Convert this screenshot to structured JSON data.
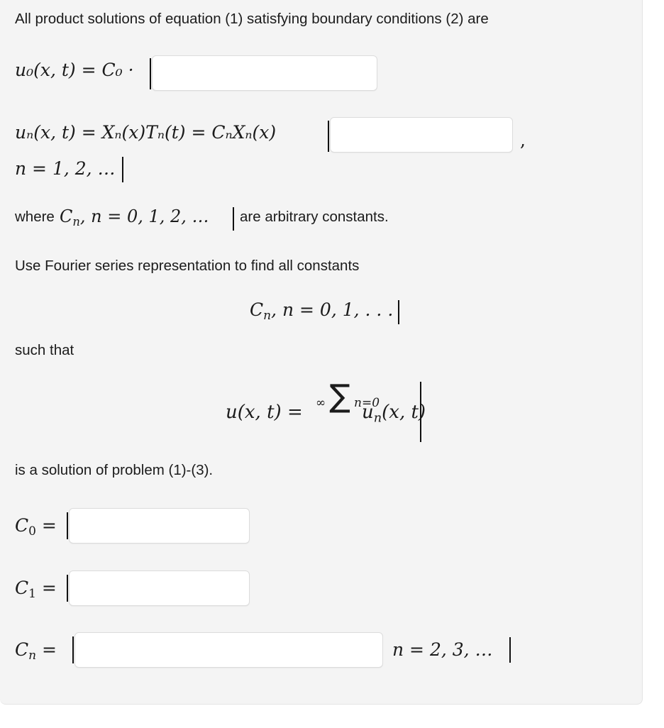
{
  "panel": {
    "background_color": "#f4f4f4",
    "border_color": "#e4e4e4"
  },
  "intro": {
    "line1": "All product solutions of equation (1) satisfying boundary conditions (2) are"
  },
  "equations": {
    "u0": {
      "lhs_u": "u",
      "lhs_sub": "0",
      "lhs_args": "(x, t) = C",
      "lhs_c_sub": "0",
      "dot": "·",
      "full_text": "u₀(x, t) = C₀ ·"
    },
    "un": {
      "part1_u": "u",
      "part1_sub": "n",
      "part1_rest": "(x, t) = X",
      "part2_sub": "n",
      "part2_rest": "(x)T",
      "part3_sub": "n",
      "part3_rest": "(t) = C",
      "part4_sub": "n",
      "part4_rest": "X",
      "part5_sub": "n",
      "part5_rest": "(x)",
      "full_text": "uₙ(x, t) = Xₙ(x)Tₙ(t) = CₙXₙ(x)",
      "trailing_comma": ",",
      "index_line": "n = 1, 2, …"
    }
  },
  "where_line": {
    "prefix": "where",
    "math_c": "C",
    "math_sub": "n",
    "math_rest": ", n = 0, 1, 2, …",
    "suffix": "are arbitrary constants."
  },
  "fourier_line": "Use Fourier series representation to find all constants",
  "constants_display": {
    "c": "C",
    "sub": "n",
    "rest": ", n = 0, 1, . . ."
  },
  "such_that_line": "such that",
  "series": {
    "lhs": "u(x, t) =",
    "sigma": "∑",
    "sigma_upper": "∞",
    "sigma_lower": "n=0",
    "rhs_u": "u",
    "rhs_sub": "n",
    "rhs_rest": "(x, t)"
  },
  "closing_line": "is a solution of problem (1)-(3).",
  "answers": [
    {
      "label_c": "C",
      "label_sub": "0",
      "equals": "=",
      "value": "",
      "placeholder": ""
    },
    {
      "label_c": "C",
      "label_sub": "1",
      "equals": "=",
      "value": "",
      "placeholder": ""
    },
    {
      "label_c": "C",
      "label_sub": "n",
      "equals": "=",
      "value": "",
      "placeholder": "",
      "trailing_math": "n = 2, 3, …"
    }
  ],
  "inline_answers": [
    {
      "value": "",
      "placeholder": ""
    },
    {
      "value": "",
      "placeholder": ""
    }
  ]
}
